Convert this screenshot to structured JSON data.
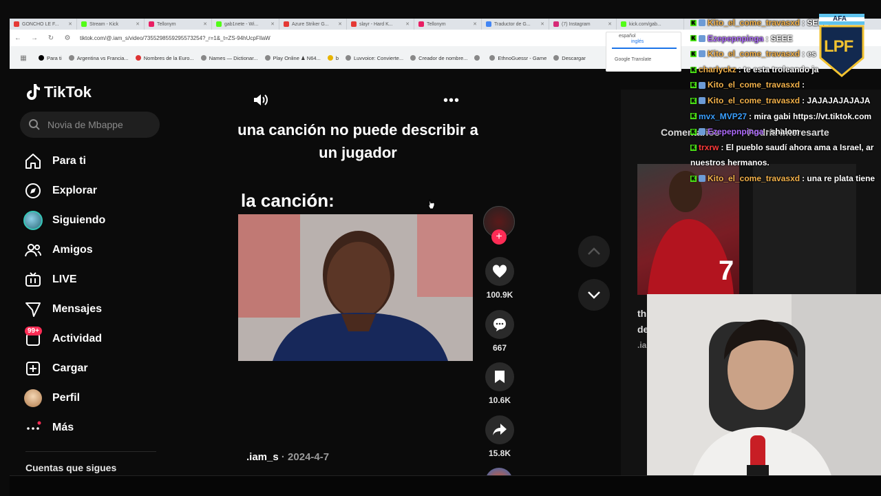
{
  "browser": {
    "tabs": [
      {
        "title": "GONCHO LE F...",
        "color": "#e53935"
      },
      {
        "title": "Stream - Kick",
        "color": "#53fc18"
      },
      {
        "title": "Tellonym",
        "color": "#e91e63"
      },
      {
        "title": "gab1nete - Wi...",
        "color": "#53fc18"
      },
      {
        "title": "Azure Striker G...",
        "color": "#e53935"
      },
      {
        "title": "slayr - Hard K...",
        "color": "#e53935"
      },
      {
        "title": "Tellonym",
        "color": "#e91e63"
      },
      {
        "title": "Traductor de G...",
        "color": "#4285f4"
      },
      {
        "title": "(7) Instagram",
        "color": "#d62976"
      },
      {
        "title": "kick.com/gab...",
        "color": "#53fc18"
      }
    ],
    "url": "tiktok.com/@.iam_s/video/7355298559295573254?_r=1&_t=ZS-94hUcpFIlaW",
    "bookmarks": [
      "Para ti",
      "Argentina vs Francia...",
      "Nombres de la Euro...",
      "Names — Dictionar...",
      "Play Online ♟ N64...",
      "b",
      "Luvvoice: Convierte...",
      "Creador de nombre...",
      "",
      "EthnoGuessr - Game",
      "Descargar"
    ],
    "translate_popup": {
      "lang_active": "inglés",
      "lang_other": "español",
      "provider": "Google Translate"
    }
  },
  "tiktok": {
    "logo": "TikTok",
    "search_placeholder": "Novia de Mbappe",
    "nav": [
      {
        "label": "Para ti",
        "icon": "home-icon"
      },
      {
        "label": "Explorar",
        "icon": "compass-icon"
      },
      {
        "label": "Siguiendo",
        "icon": "avatar"
      },
      {
        "label": "Amigos",
        "icon": "friends-icon"
      },
      {
        "label": "LIVE",
        "icon": "live-icon"
      },
      {
        "label": "Mensajes",
        "icon": "messages-icon"
      },
      {
        "label": "Actividad",
        "icon": "activity-icon",
        "badge": "99+"
      },
      {
        "label": "Cargar",
        "icon": "upload-icon"
      },
      {
        "label": "Perfil",
        "icon": "profile-avatar"
      },
      {
        "label": "Más",
        "icon": "more-icon"
      }
    ],
    "following_heading": "Cuentas que sigues",
    "video": {
      "caption_top": "una canción no puede describir a un jugador",
      "caption_mid": "la canción:",
      "author": ".iam_s",
      "date": "2024-4-7",
      "separator": " · "
    },
    "actions": {
      "likes": "100.9K",
      "comments": "667",
      "saves": "10.6K",
      "shares": "15.8K"
    },
    "right_panel": {
      "tabs": [
        "Comentarios",
        "Podría interesarte"
      ],
      "thumb_text": [
        "th",
        "de",
        ".ia"
      ]
    }
  },
  "chat": [
    {
      "user": "Kito_el_come_travasxd",
      "text": " : SEEE",
      "color": "#f2b14a"
    },
    {
      "user": "Ezepepnpinga",
      "text": " : SEEE",
      "color": "#b06cff"
    },
    {
      "user": "Kito_el_come_travasxd",
      "text": " : es",
      "color": "#f2b14a"
    },
    {
      "user": "charlyckz",
      "text": " : te esta troleando ja",
      "color": "#f2b14a"
    },
    {
      "user": "Kito_el_come_travasxd",
      "text": " : ",
      "color": "#f2b14a"
    },
    {
      "user": "Kito_el_come_travasxd",
      "text": " : JAJAJAJAJAJA",
      "color": "#f2b14a"
    },
    {
      "user": "mvx_MVP27",
      "text": " : mira gabi https://vt.tiktok.com",
      "color": "#3aa0ff"
    },
    {
      "user": "Ezepepnpinga",
      "text": " : shalom",
      "color": "#b06cff"
    },
    {
      "user": "trxrw",
      "text": " : El pueblo saudí ahora ama a Israel, ar",
      "color": "#ff3b3b"
    },
    {
      "user": "",
      "text": "nuestros hermanos.",
      "color": "#ffffff"
    },
    {
      "user": "Kito_el_come_travasxd",
      "text": " : una re plata tiene",
      "color": "#f2b14a"
    }
  ],
  "overlay_logo": {
    "text": "AFA",
    "mark": "LPF"
  },
  "colors": {
    "tiktok_red": "#fe2c55",
    "kick_green": "#53fc18"
  }
}
